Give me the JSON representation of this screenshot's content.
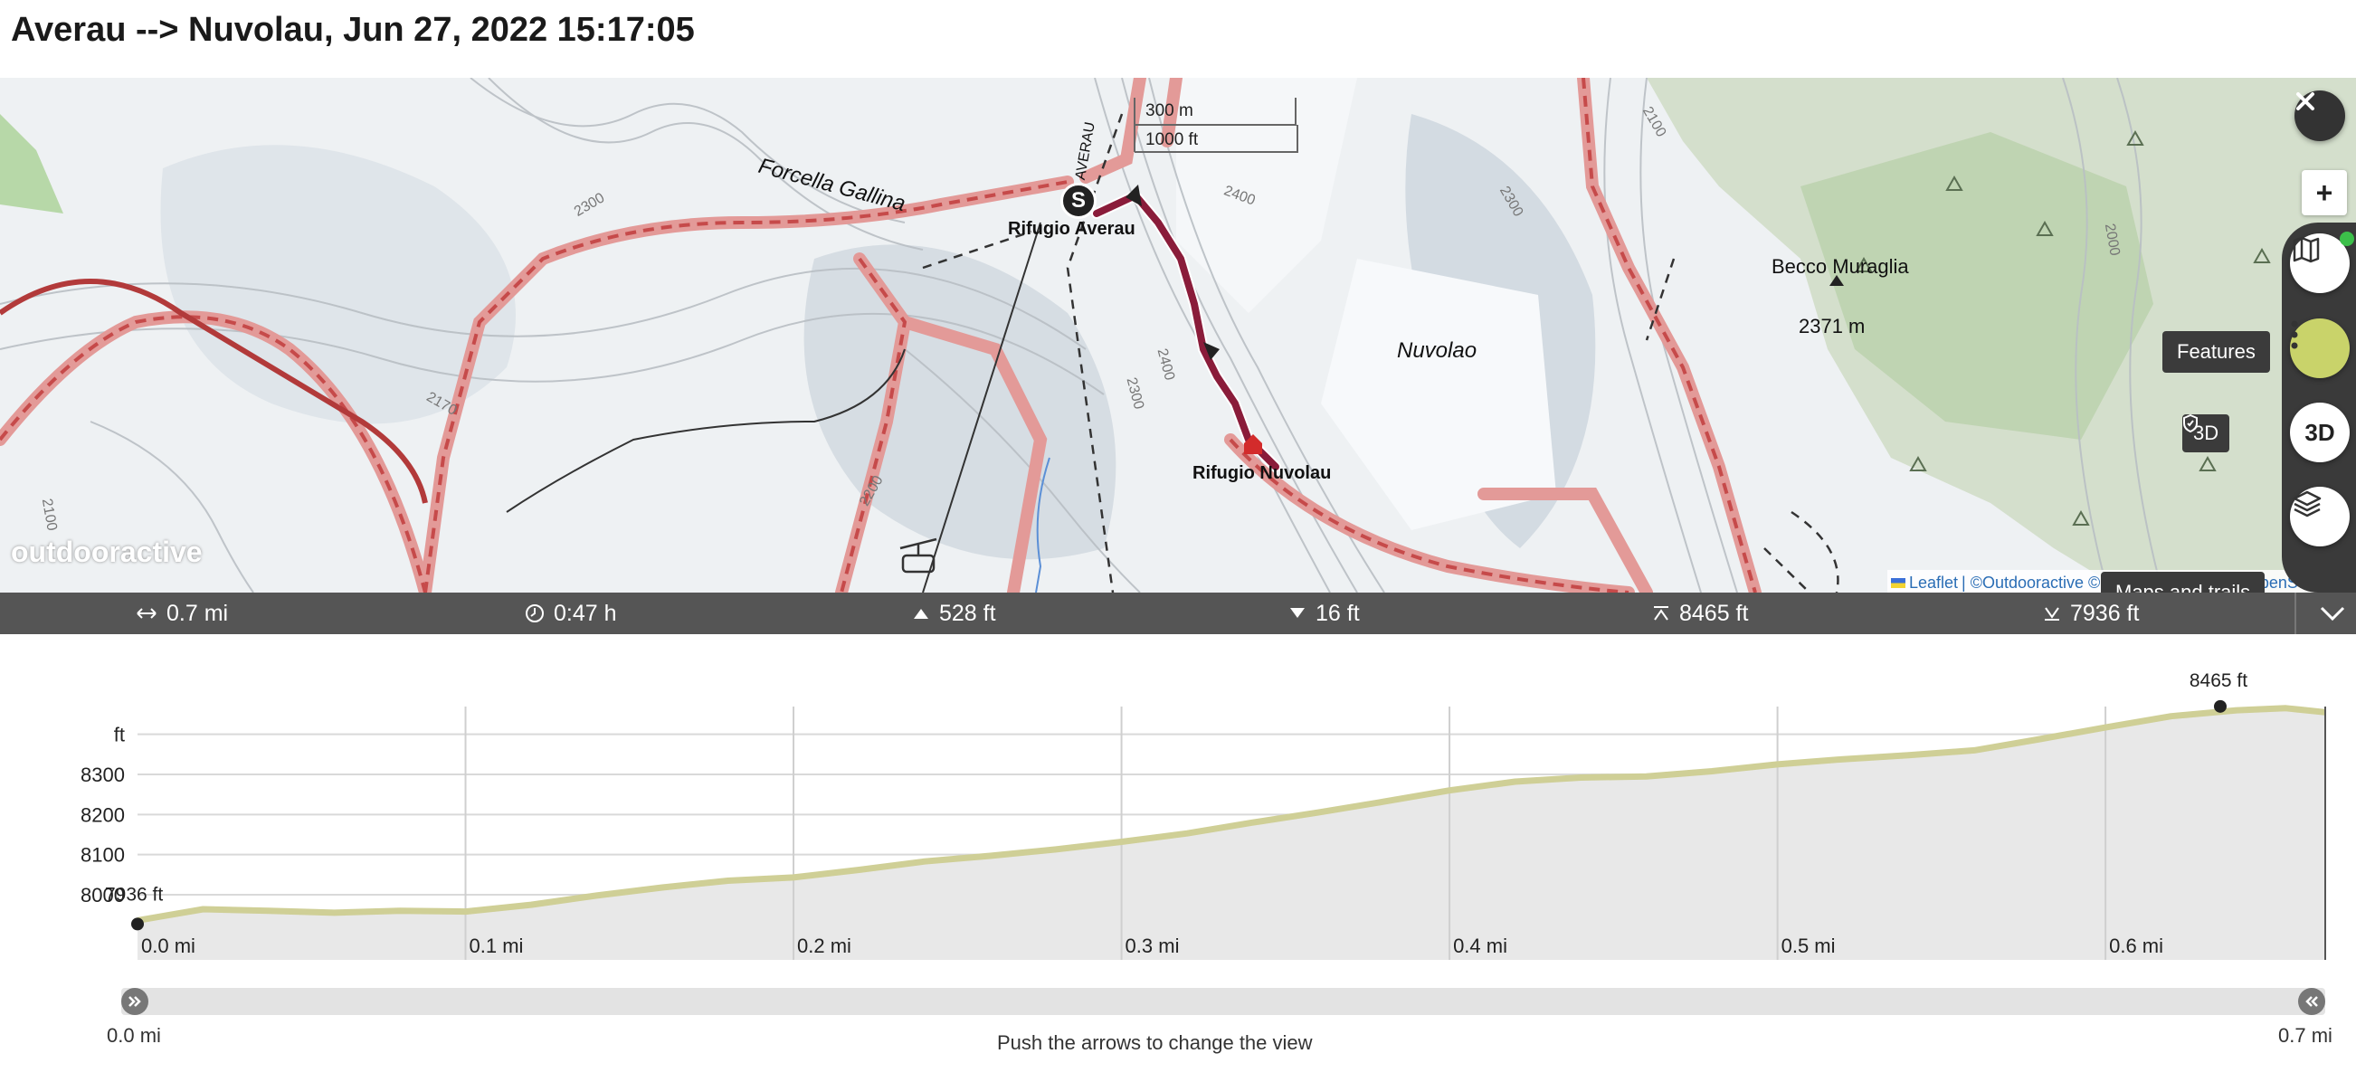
{
  "header": {
    "title": "Averau --> Nuvolau, Jun 27, 2022 15:17:05"
  },
  "map": {
    "labels": {
      "forcella": "Forcella Gallina",
      "averau": "Rifugio Averau",
      "averau_vertical": "AVERAU",
      "nuvolau": "Rifugio Nuvolau",
      "nuvolao": "Nuvolao",
      "becco": "Becco Muraglia",
      "becco_elev": "2371 m",
      "start_marker": "S",
      "contours": [
        "2100",
        "2300",
        "2400",
        "2400",
        "2300",
        "2200",
        "2100",
        "2000",
        "2300",
        "2170"
      ]
    },
    "scale": {
      "metric": "300 m",
      "imperial": "1000 ft"
    },
    "watermark": "outdooractive",
    "attribution": {
      "leaflet": "Leaflet",
      "rest": "| ©Outdooractive © swisstopo © IGN © OpenStreetM"
    },
    "controls": {
      "close": "close-icon",
      "zoom_in": "+",
      "features_label": "Features",
      "three_d_badge": "3D",
      "three_d_button": "3D",
      "maps_label": "Maps and trails"
    },
    "colors": {
      "route": "#8a1c3a",
      "trail": "#d9534f",
      "accent": "#c9d36a",
      "online_dot": "#3cbf4a"
    }
  },
  "stats": {
    "distance": "0.7 mi",
    "duration": "0:47 h",
    "ascent": "528 ft",
    "descent": "16 ft",
    "max_elev": "8465 ft",
    "min_elev": "7936 ft"
  },
  "chart_data": {
    "type": "area",
    "title": "",
    "xlabel": "",
    "ylabel": "ft",
    "x_ticks": [
      "0.0 mi",
      "0.1 mi",
      "0.2 mi",
      "0.3 mi",
      "0.4 mi",
      "0.5 mi",
      "0.6 mi"
    ],
    "y_ticks": [
      "8000",
      "8100",
      "8200",
      "8300"
    ],
    "xlim": [
      0,
      0.667
    ],
    "ylim": [
      7936,
      8400
    ],
    "x": [
      0.0,
      0.02,
      0.04,
      0.06,
      0.08,
      0.1,
      0.12,
      0.14,
      0.16,
      0.18,
      0.2,
      0.22,
      0.24,
      0.26,
      0.28,
      0.3,
      0.32,
      0.34,
      0.36,
      0.38,
      0.4,
      0.42,
      0.44,
      0.46,
      0.48,
      0.5,
      0.52,
      0.54,
      0.56,
      0.58,
      0.6,
      0.62,
      0.64,
      0.655,
      0.667
    ],
    "values": [
      7936,
      7964,
      7960,
      7955,
      7960,
      7958,
      7975,
      7998,
      8018,
      8035,
      8043,
      8062,
      8083,
      8097,
      8113,
      8132,
      8153,
      8180,
      8205,
      8232,
      8260,
      8282,
      8292,
      8295,
      8308,
      8325,
      8338,
      8348,
      8360,
      8388,
      8417,
      8445,
      8460,
      8465,
      8455
    ],
    "annotations": [
      {
        "label": "8465 ft",
        "x": 0.635,
        "y": 8465
      },
      {
        "label": "7936 ft",
        "x": 0.0,
        "y": 7936
      }
    ],
    "grid": true,
    "colors": {
      "line": "#cfcf96",
      "fill": "#e8e8e8"
    }
  },
  "slider": {
    "left_label": "0.0 mi",
    "right_label": "0.7 mi",
    "hint": "Push the arrows to change the view"
  }
}
